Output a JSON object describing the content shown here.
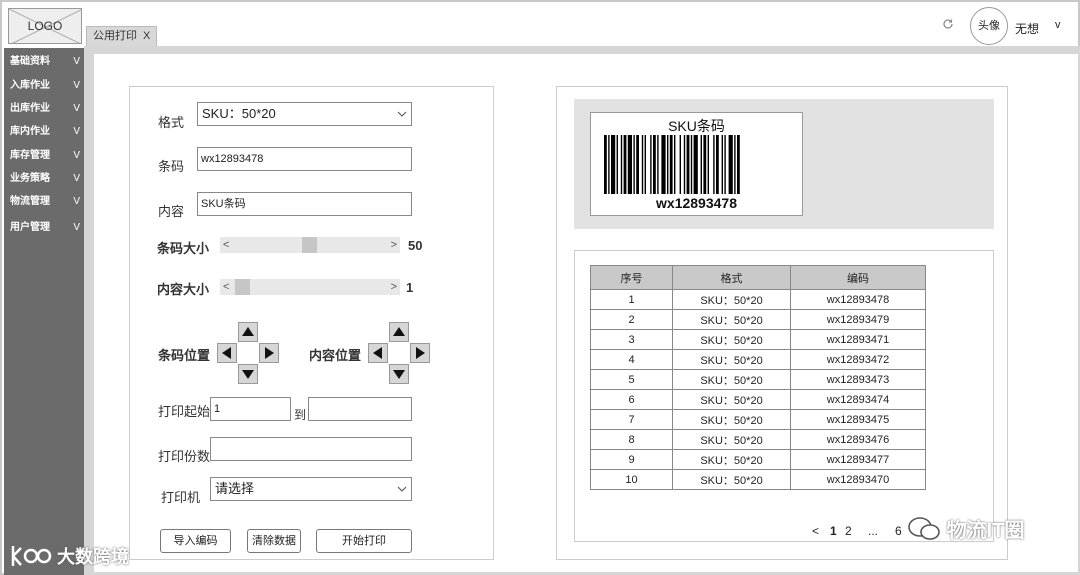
{
  "header": {
    "logo_text": "LOGO",
    "tab_label": "公用打印",
    "tab_close": "X",
    "avatar_text": "头像",
    "username": "无想",
    "user_menu_caret": "v",
    "refresh_icon": "refresh-icon"
  },
  "sidebar": {
    "items": [
      {
        "label": "基础资料",
        "chevron": "V"
      },
      {
        "label": "入库作业",
        "chevron": "V"
      },
      {
        "label": "出库作业",
        "chevron": "V"
      },
      {
        "label": "库内作业",
        "chevron": "V"
      },
      {
        "label": "库存管理",
        "chevron": "V"
      },
      {
        "label": "业务策略",
        "chevron": "V"
      },
      {
        "label": "物流管理",
        "chevron": "V"
      },
      {
        "label": "用户管理",
        "chevron": "V"
      }
    ]
  },
  "form": {
    "format_label": "格式",
    "format_value": "SKU：50*20",
    "barcode_label": "条码",
    "barcode_value": "wx12893478",
    "content_label": "内容",
    "content_value": "SKU条码",
    "barcode_size_label": "条码大小",
    "barcode_size_value": "50",
    "barcode_size_fraction": 0.46,
    "content_size_label": "内容大小",
    "content_size_value": "1",
    "content_size_fraction": 0.02,
    "barcode_position_label": "条码位置",
    "content_position_label": "内容位置",
    "print_start_label": "打印起始",
    "print_start_from": "1",
    "print_start_to_label": "到",
    "print_start_to": "",
    "print_copies_label": "打印份数",
    "print_copies_value": "",
    "printer_label": "打印机",
    "printer_value": "请选择",
    "slider_left": "<",
    "slider_right": ">"
  },
  "buttons": {
    "import": "导入编码",
    "clear": "清除数据",
    "print": "开始打印"
  },
  "preview": {
    "title": "SKU条码",
    "code": "wx12893478"
  },
  "table": {
    "columns": [
      "序号",
      "格式",
      "编码"
    ],
    "rows": [
      [
        "1",
        "SKU：50*20",
        "wx12893478"
      ],
      [
        "2",
        "SKU：50*20",
        "wx12893479"
      ],
      [
        "3",
        "SKU：50*20",
        "wx12893471"
      ],
      [
        "4",
        "SKU：50*20",
        "wx12893472"
      ],
      [
        "5",
        "SKU：50*20",
        "wx12893473"
      ],
      [
        "6",
        "SKU：50*20",
        "wx12893474"
      ],
      [
        "7",
        "SKU：50*20",
        "wx12893475"
      ],
      [
        "8",
        "SKU：50*20",
        "wx12893476"
      ],
      [
        "9",
        "SKU：50*20",
        "wx12893477"
      ],
      [
        "10",
        "SKU：50*20",
        "wx12893470"
      ]
    ]
  },
  "pager": {
    "prev": "<",
    "page1": "1",
    "page2": "2",
    "ellipsis": "...",
    "last": "6"
  },
  "watermarks": {
    "left": "大数跨境",
    "right": "物流IT圈"
  }
}
